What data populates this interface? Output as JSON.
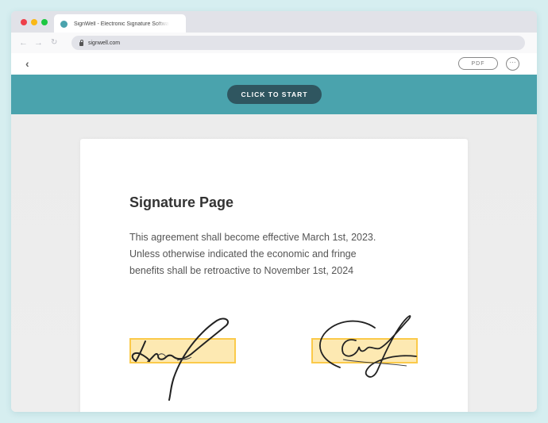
{
  "browser": {
    "tab_title": "SignWell - Electronic Signature Software",
    "url": "signwell.com",
    "icons": {
      "back": "arrow-left-icon",
      "forward": "arrow-right-icon",
      "reload": "reload-icon",
      "lock": "lock-icon"
    }
  },
  "toolbar": {
    "back_icon": "‹",
    "pdf_label": "PDF",
    "more_icon": "···"
  },
  "banner": {
    "start_label": "CLICK TO START",
    "color": "#4aa3ad",
    "button_color": "#2f5660"
  },
  "document": {
    "title": "Signature Page",
    "body_lines": [
      "This agreement shall become effective March 1st, 2023.",
      "Unless otherwise indicated the economic and fringe",
      "benefits shall be retroactive to November 1st, 2024"
    ],
    "signature_fields": [
      {
        "state": "signed"
      },
      {
        "state": "signed"
      }
    ],
    "field_color": "#fde9b2",
    "field_border": "#fbca4a"
  }
}
